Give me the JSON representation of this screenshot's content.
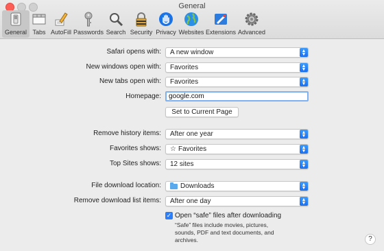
{
  "window": {
    "title": "General"
  },
  "toolbar": {
    "items": [
      {
        "label": "General",
        "icon": "general-switch-icon",
        "selected": true
      },
      {
        "label": "Tabs",
        "icon": "tabs-icon"
      },
      {
        "label": "AutoFill",
        "icon": "autofill-pencil-icon"
      },
      {
        "label": "Passwords",
        "icon": "key-icon"
      },
      {
        "label": "Search",
        "icon": "magnifier-icon"
      },
      {
        "label": "Security",
        "icon": "lock-icon"
      },
      {
        "label": "Privacy",
        "icon": "hand-icon"
      },
      {
        "label": "Websites",
        "icon": "globe-icon"
      },
      {
        "label": "Extensions",
        "icon": "extensions-icon"
      },
      {
        "label": "Advanced",
        "icon": "gear-icon"
      }
    ]
  },
  "settings": {
    "safari_opens_with": {
      "label": "Safari opens with:",
      "value": "A new window"
    },
    "new_windows_open_with": {
      "label": "New windows open with:",
      "value": "Favorites"
    },
    "new_tabs_open_with": {
      "label": "New tabs open with:",
      "value": "Favorites"
    },
    "homepage": {
      "label": "Homepage:",
      "value": "google.com"
    },
    "set_current_page": {
      "label": "Set to Current Page"
    },
    "remove_history": {
      "label": "Remove history items:",
      "value": "After one year"
    },
    "favorites_shows": {
      "label": "Favorites shows:",
      "value": "Favorites",
      "icon": "star-icon"
    },
    "top_sites_shows": {
      "label": "Top Sites shows:",
      "value": "12 sites"
    },
    "file_download_location": {
      "label": "File download location:",
      "value": "Downloads",
      "icon": "folder-icon"
    },
    "remove_download_list": {
      "label": "Remove download list items:",
      "value": "After one day"
    },
    "open_safe_files": {
      "label": "Open “safe” files after downloading",
      "checked": true,
      "note": "“Safe” files include movies, pictures, sounds, PDF and text documents, and archives."
    }
  },
  "help": {
    "label": "?"
  },
  "colors": {
    "accent": "#2d7ff9",
    "close": "#fd5f57"
  }
}
